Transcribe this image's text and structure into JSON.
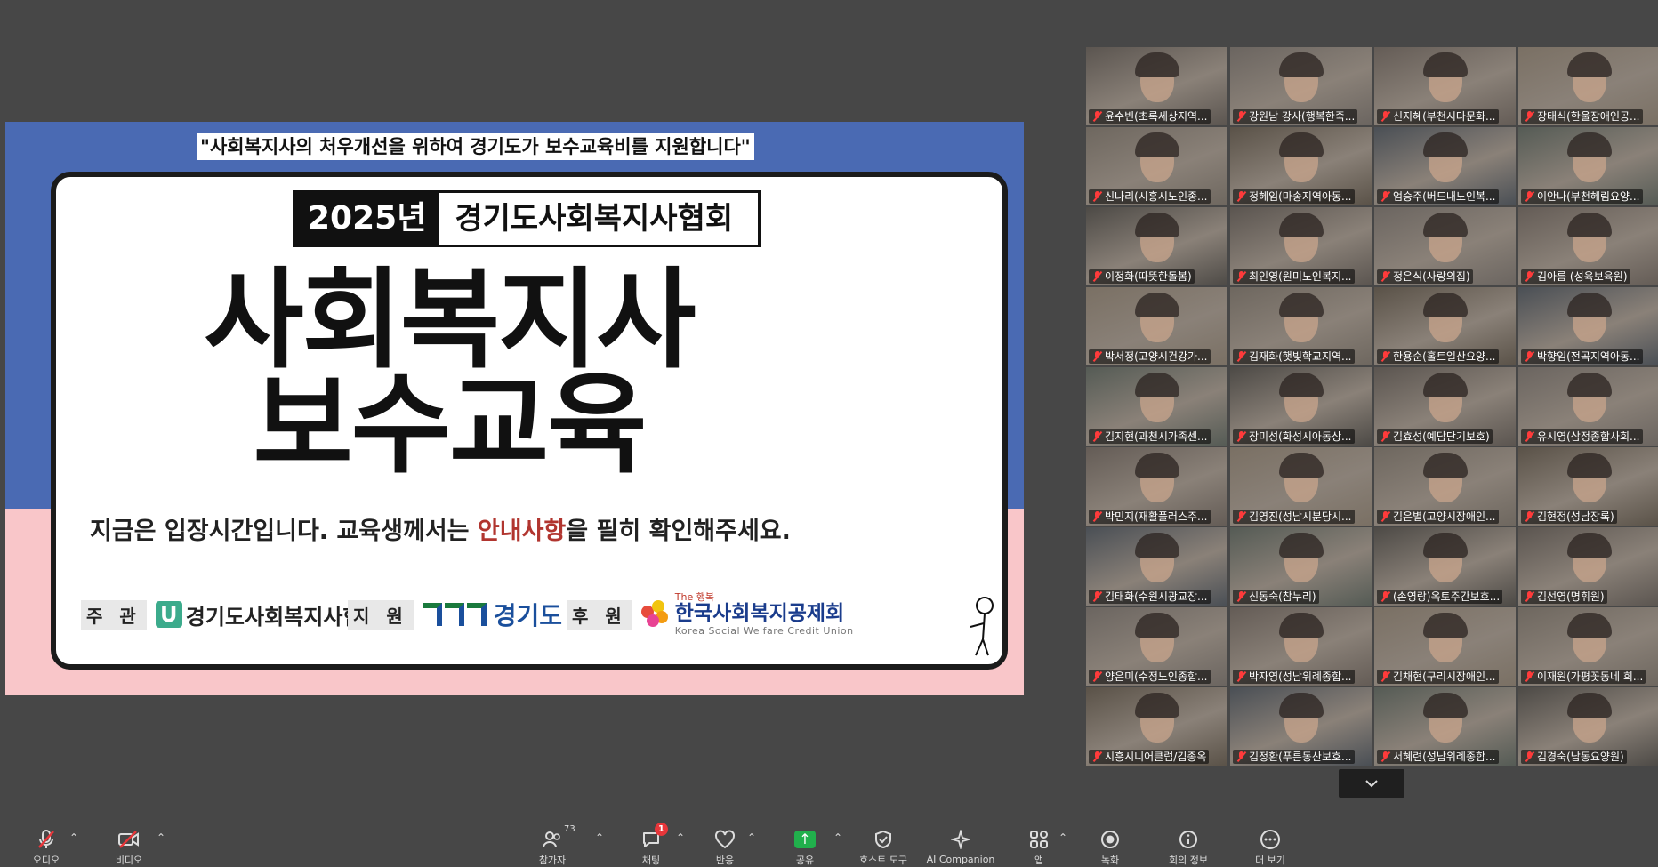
{
  "slide": {
    "banner": "\"사회복지사의 처우개선을 위하여 경기도가 보수교육비를 지원합니다\"",
    "year": "2025년",
    "org": "경기도사회복지사협회",
    "title_line1": "사회복지사",
    "title_line2": "보수교육",
    "notice_pre": "지금은 입장시간입니다.  교육생께서는 ",
    "notice_highlight": "안내사항",
    "notice_post": "을 필히 확인해주세요.",
    "sponsors": {
      "host_role": "주 관",
      "host_logo_letter": "U",
      "host_name": "경기도사회복지사협회",
      "support_role": "지 원",
      "support_name": "경기도",
      "sponsor_role": "후 원",
      "sponsor_the": "The 행복",
      "sponsor_name": "한국사회복지공제회",
      "sponsor_en": "Korea Social Welfare Credit Union"
    },
    "colors": {
      "top_band": "#4a6ab3",
      "bottom_band": "#f9c6c9",
      "highlight": "#b1352f"
    }
  },
  "gallery": {
    "participants": [
      "윤수빈(초록세상지역...",
      "강원남 강사(행복한죽...",
      "신지혜(부천시다문화...",
      "장태식(한울장애인공...",
      "신나리(시흥시노인종...",
      "정혜임(마송지역아동...",
      "엄승주(버드내노인복...",
      "이안나(부천혜림요양...",
      "이정화(따뜻한돌봄)",
      "최인영(원미노인복지...",
      "정은식(사랑의집)",
      "김아름 (성육보육원)",
      "박서정(고양시건강가...",
      "김재화(햇빛학교지역...",
      "한용순(홀트일산요양...",
      "박향임(전곡지역아동...",
      "김지현(과천시가족센...",
      "장미성(화성시아동상...",
      "김효성(예담단기보호)",
      "유시영(삼정종합사회...",
      "박민지(재활플러스주...",
      "김영진(성남시분당시...",
      "김은별(고양시장애인...",
      "김현정(성남장록)",
      "김태화(수원시광교장...",
      "신동숙(참누리)",
      "(손영랑)옥토주간보호...",
      "김선영(명휘원)",
      "양은미(수정노인종합...",
      "박자영(성남위례종합...",
      "김채현(구리시장애인...",
      "이재원(가평꽃동네 희...",
      "시흥시니어클럽/김종옥",
      "김정환(푸른동산보호...",
      "서혜련(성남위례종합...",
      "김경숙(남동요양원)"
    ]
  },
  "toolbar": {
    "audio": "오디오",
    "video": "비디오",
    "participants": "참가자",
    "participants_count": "73",
    "chat": "채팅",
    "chat_badge": "1",
    "reactions": "반응",
    "share": "공유",
    "host_tools": "호스트 도구",
    "ai_companion": "AI Companion",
    "apps": "앱",
    "record": "녹화",
    "meeting_info": "회의 정보",
    "more": "더 보기"
  },
  "icons": {
    "audio": "mic-muted-icon",
    "video": "camera-off-icon",
    "participants": "people-icon",
    "chat": "chat-bubble-icon",
    "reactions": "heart-icon",
    "share": "share-arrow-icon",
    "host_tools": "shield-icon",
    "ai_companion": "sparkle-icon",
    "apps": "apps-icon",
    "record": "record-icon",
    "meeting_info": "info-icon",
    "more": "more-dots-icon"
  }
}
